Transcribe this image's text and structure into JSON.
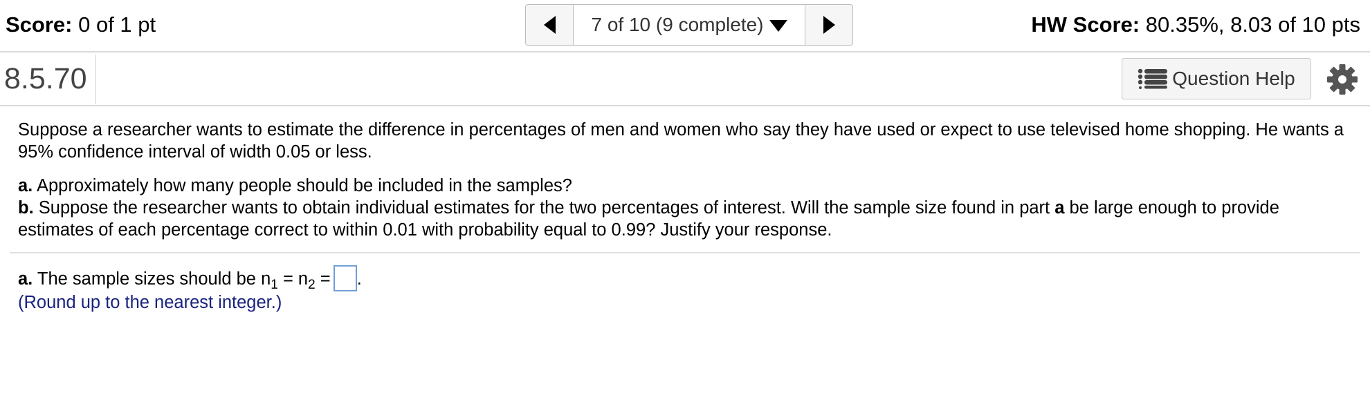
{
  "topbar": {
    "score_label": "Score:",
    "score_value": "0 of 1 pt",
    "nav_position": "7 of 10 (9 complete)",
    "hw_score_label": "HW Score:",
    "hw_score_value": "80.35%, 8.03 of 10 pts"
  },
  "question": {
    "number": "8.5.70",
    "help_label": "Question Help"
  },
  "problem": {
    "intro": "Suppose a researcher wants to estimate the difference in percentages of men and women who say they have used or expect to use televised home shopping. He wants a 95% confidence interval of width 0.05 or less.",
    "part_a_label": "a.",
    "part_a_text": "Approximately how many people should be included in the samples?",
    "part_b_label": "b.",
    "part_b_text_1": "Suppose the researcher wants to obtain individual estimates for the two percentages of interest. Will the sample size found in part",
    "part_b_bold": "a",
    "part_b_text_2": "be large enough to provide estimates of each percentage correct to within 0.01 with probability equal to 0.99? Justify your response."
  },
  "answer": {
    "label": "a.",
    "text": "The sample sizes should be n",
    "sub1": "1",
    "eq": "= n",
    "sub2": "2",
    "eq2": "=",
    "value": "",
    "end": ".",
    "hint": "(Round up to the nearest integer.)"
  },
  "icons": {
    "prev": "triangle-left-icon",
    "next": "triangle-right-icon",
    "dropdown": "triangle-down-icon",
    "help": "list-icon",
    "settings": "gear-icon"
  }
}
